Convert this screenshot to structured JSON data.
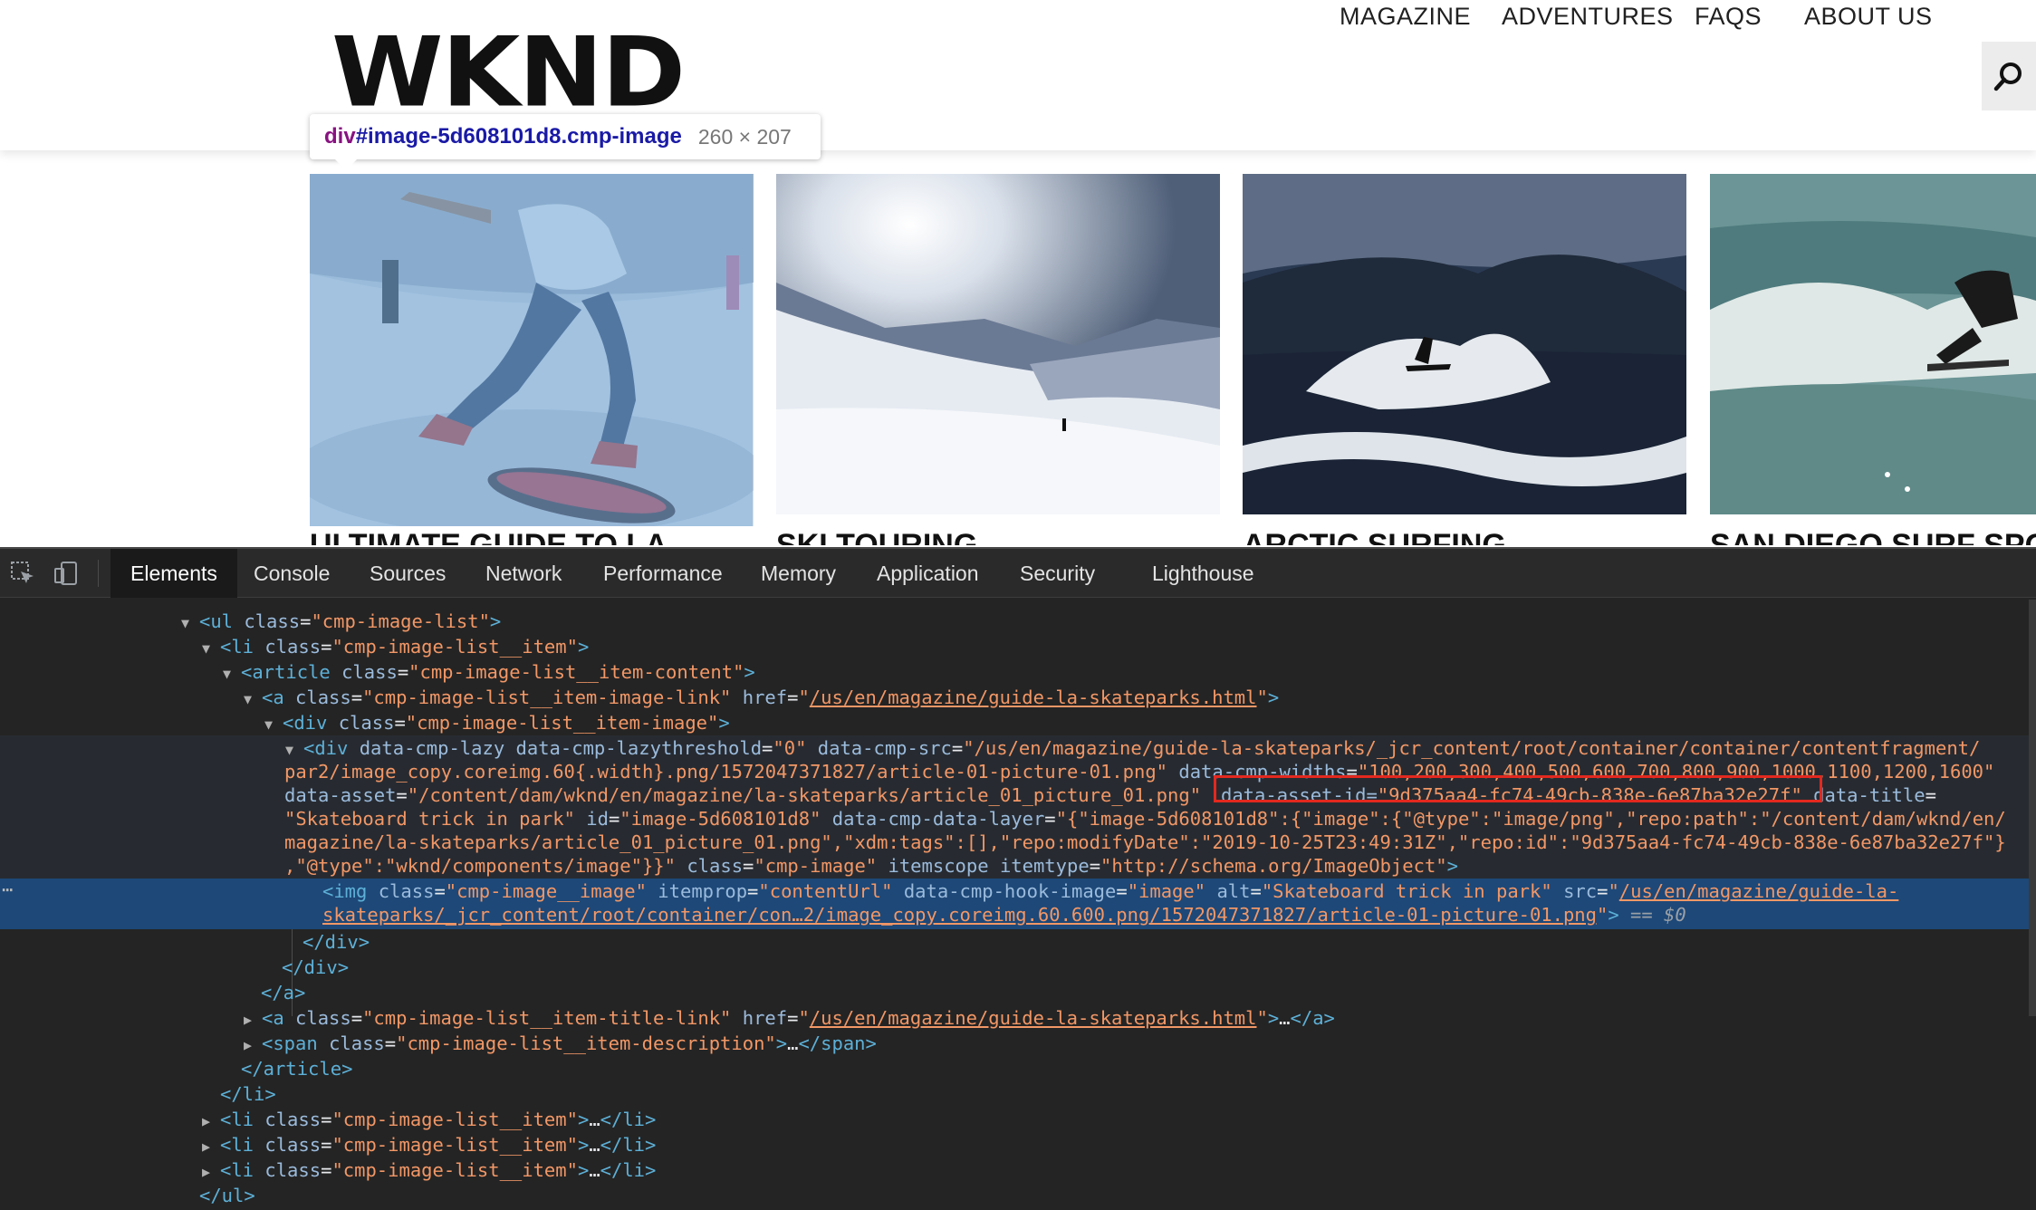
{
  "site": {
    "logo": "WKND",
    "nav": [
      "MAGAZINE",
      "ADVENTURES",
      "FAQS",
      "ABOUT US"
    ]
  },
  "tooltip": {
    "tag": "div",
    "selector": "#image-5d608101d8.cmp-image",
    "size": "260 × 207"
  },
  "cards": [
    {
      "title": "ULTIMATE GUIDE TO LA"
    },
    {
      "title": "SKI TOURING"
    },
    {
      "title": "ARCTIC SURFING"
    },
    {
      "title": "SAN DIEGO SURF SPOTS"
    }
  ],
  "devtools": {
    "tabs": [
      "Elements",
      "Console",
      "Sources",
      "Network",
      "Performance",
      "Memory",
      "Application",
      "Security",
      "Lighthouse"
    ],
    "active_tab": "Elements",
    "selected_suffix": " == $0",
    "dom": {
      "ul_class": "\"cmp-image-list\"",
      "li_class": "\"cmp-image-list__item\"",
      "article_class": "\"cmp-image-list__item-content\"",
      "a_class": "\"cmp-image-list__item-image-link\"",
      "a_href": "/us/en/magazine/guide-la-skateparks.html",
      "divimg_class": "\"cmp-image-list__item-image\"",
      "lazy_threshold": "\"0\"",
      "cmp_src_1": "\"/us/en/magazine/guide-la-skateparks/_jcr_content/root/container/container/contentfragment/",
      "cmp_src_2": "par2/image_copy.coreimg.60{.width}.png/1572047371827/article-01-picture-01.png\"",
      "cmp_widths": "\"100,200,300,400,500,600,700,800,900,1000,1100,1200,1600\"",
      "data_asset": "\"/content/dam/wknd/en/magazine/la-skateparks/article_01_picture_01.png\"",
      "data_asset_id_attr": "data-asset-id=",
      "data_asset_id": "\"9d375aa4-fc74-49cb-838e-6e87ba32e27f\"",
      "data_title": "\"Skateboard trick in park\"",
      "div_id": "\"image-5d608101d8\"",
      "data_layer_1": "{\"image-5d608101d8\":{\"image\":{\"@type\":\"image/png\",\"repo:path\":\"/content/dam/wknd/en/",
      "data_layer_2": "magazine/la-skateparks/article_01_picture_01.png\",\"xdm:tags\":[],\"repo:modifyDate\":\"2019-10-25T23:49:31Z\",\"repo:id\":\"9d375aa4-fc74-49cb-838e-6e87ba32e27f\"}",
      "data_layer_3": ",\"@type\":\"wknd/components/image\"}}\"",
      "div_class": "\"cmp-image\"",
      "itemtype": "\"http://schema.org/ImageObject\"",
      "img_class": "\"cmp-image__image\"",
      "img_itemprop": "\"contentUrl\"",
      "img_hook": "\"image\"",
      "img_alt": "\"Skateboard trick in park\"",
      "img_src_1": "/us/en/magazine/guide-la-",
      "img_src_2": "skateparks/_jcr_content/root/container/con…2/image_copy.coreimg.60.600.png/1572047371827/article-01-picture-01.png",
      "title_link_class": "\"cmp-image-list__item-title-link\"",
      "desc_class": "\"cmp-image-list__item-description\""
    }
  }
}
